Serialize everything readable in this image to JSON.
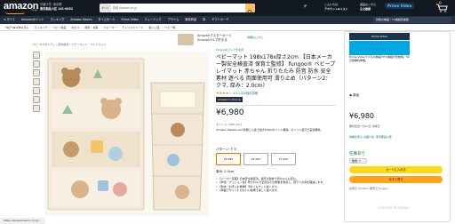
{
  "header": {
    "logo": "amazon",
    "logo_sub": ".co.jp",
    "deliver_line1": "お届け先: 東京都",
    "deliver_line2": "東京都品川区 141-0032",
    "search_category": "すべて",
    "search_placeholder": "検索 Amazon.co.jp",
    "lang": "JP",
    "account_line1": "こんにちは",
    "account_line2": "アカウント&リスト",
    "orders_line1": "返品もこちら",
    "orders_line2": "注文履歴",
    "prime_video": "Prime Video",
    "cart_count": "0"
  },
  "nav": {
    "items": [
      "≡ すべて",
      "Amazonポイント",
      "ランキング",
      "Amazon Basics",
      "タイムセール",
      "Prime Video",
      "ミュージック",
      "プライム",
      "新着商品",
      "本",
      "ギフトカード"
    ],
    "right_promo": "対象の映画・TV番組見放題"
  },
  "subnav": {
    "items": [
      "ベビー&マタニティ",
      "ランキング",
      "ベビー用品",
      "おむつ",
      "授乳・食事",
      "ベビーカー",
      "チャイルドシート",
      "抱っこ紐",
      "ベビー服"
    ]
  },
  "banner": {
    "line1": "Amazonマスターカード",
    "line2": "Amazon2%で貯まる",
    "link": "詳細はこちら"
  },
  "breadcrumb": "ベビー&マタニティ › 室内遊具 › ベビーマット・プレイマット",
  "product": {
    "brand_link": "fungooのストアを表示",
    "title": "ベビーマット 198x178x厚さ2cm 【日本メーカー製安全検査済 保育士監修】 fungoo® ベビープレイマット 赤ちゃん 折りたたみ 防音 防水 安全素材 遊べる 両面使用可 滑り止め（パターン2：クマ, 厚み：2.0cm）",
    "stars": "★★★★☆",
    "rating_text": "4.3   1,520個の評価",
    "badge": "Amazon's Choice",
    "price": "¥6,980",
    "points": "ポイント: 70pt (1%)",
    "mastercard": "Amazon Mastercard 新規ご入会で最大8,000ポイント獲得。ポイント還元で実質無料。",
    "pattern_label": "パターン: クマ",
    "swatches": [
      "¥6,980",
      "¥6,980",
      "¥7,280"
    ],
    "size_label": "厚み: 2.0cm",
    "bullets": [
      "• 【メーカー直販】日本安全検査済。保育士監修で赤ちゃんも安心。",
      "• 【防音・クッション性】厚さ2cmで足音などの衝撃を吸収し、階下への音を軽減します。",
      "• 【防水・お手入れ簡単】汚れてもサッと拭くだけ。",
      "• 【両面デザイン】かわいい絵柄で楽しく遊べます。"
    ]
  },
  "rbox": {
    "promo_title": "Prime Video",
    "promo_text": "Prime Videoで人気の映画やTV番組が見放題。30日間無料体験。",
    "options": "◉ 新品",
    "price": "¥6,980",
    "ship": "無料配送 7月12日 水曜日",
    "delivery": "詳細を見る お届け先: 東京都品川区",
    "stock": "在庫あり",
    "qty": "数量: 1",
    "cart_btn": "カートに入れる",
    "buy_btn": "今すぐ買う",
    "info": "出荷元 Amazon  販売元 fungoo"
  },
  "status": "https://www.amazon.co.jp/...",
  "watermark": "Activate Windows"
}
